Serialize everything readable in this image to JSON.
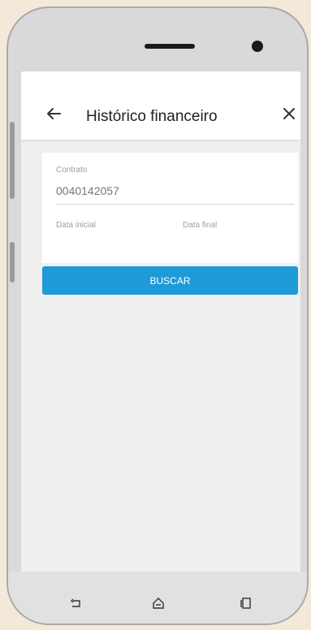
{
  "appbar": {
    "title": "Histórico financeiro",
    "back_icon": "arrow-left-icon",
    "close_icon": "close-icon"
  },
  "form": {
    "contract_label": "Contrato",
    "contract_value": "0040142057",
    "start_date_label": "Data inicial",
    "end_date_label": "Data final",
    "search_button": "BUSCAR"
  },
  "colors": {
    "accent": "#1e9ad6",
    "screen_bg": "#efefef",
    "page_bg": "#f4e9d8"
  },
  "system_nav": {
    "back_icon": "back-icon",
    "home_icon": "home-icon",
    "recents_icon": "recents-icon"
  }
}
